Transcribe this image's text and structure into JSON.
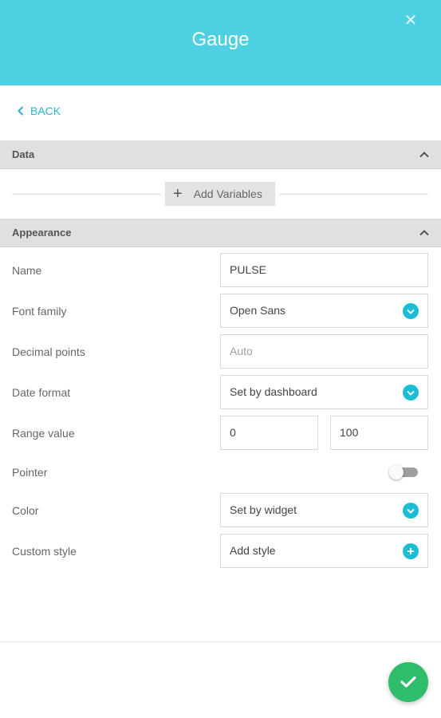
{
  "header": {
    "title": "Gauge",
    "close_glyph": "✕"
  },
  "nav": {
    "back_label": "BACK"
  },
  "sections": {
    "data": {
      "title": "Data",
      "add_variables_label": "Add Variables"
    },
    "appearance": {
      "title": "Appearance"
    }
  },
  "fields": {
    "name": {
      "label": "Name",
      "value": "PULSE"
    },
    "font_family": {
      "label": "Font family",
      "value": "Open Sans"
    },
    "decimal_points": {
      "label": "Decimal points",
      "placeholder": "Auto"
    },
    "date_format": {
      "label": "Date format",
      "value": "Set by dashboard"
    },
    "range_value": {
      "label": "Range value",
      "min": "0",
      "max": "100"
    },
    "pointer": {
      "label": "Pointer",
      "enabled": false
    },
    "color": {
      "label": "Color",
      "value": "Set by widget"
    },
    "custom_style": {
      "label": "Custom style",
      "value": "Add style"
    }
  },
  "colors": {
    "header_bg": "#4dd0e1",
    "accent": "#1bbcd6",
    "section_bg": "#e0e0e0",
    "confirm": "#2ebd6b"
  },
  "icons": {
    "close": "close-icon",
    "back": "chevron-left-icon",
    "collapse": "chevron-up-icon",
    "add": "plus-icon",
    "dropdown": "chevron-down-icon",
    "confirm": "check-icon"
  }
}
